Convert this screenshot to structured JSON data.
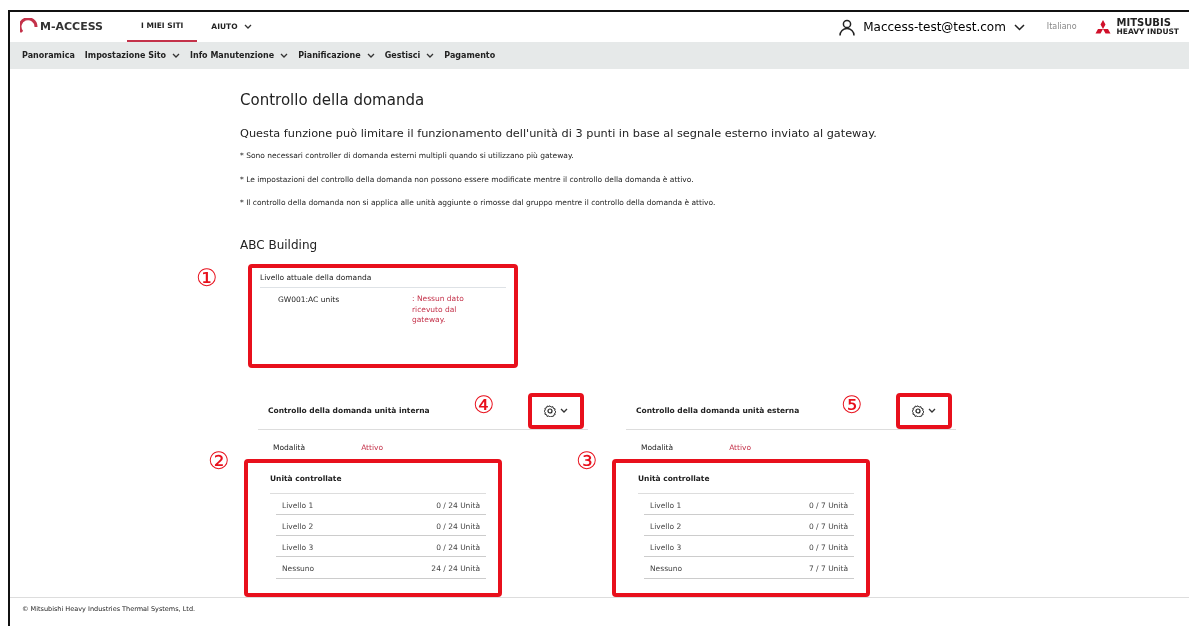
{
  "top_nav": {
    "logo": "M-ACCESS",
    "items": [
      {
        "label": "I MIEI SITI",
        "selected": true,
        "dropdown": false
      },
      {
        "label": "AIUTO",
        "selected": false,
        "dropdown": true
      }
    ],
    "user": "Maccess-test@test.com",
    "language": "Italiano",
    "brand": "MITSUBIS",
    "brand_sub": "HEAVY INDUST"
  },
  "sub_nav": [
    {
      "label": "Panoramica",
      "dropdown": false
    },
    {
      "label": "Impostazione Sito",
      "dropdown": true
    },
    {
      "label": "Info Manutenzione",
      "dropdown": true
    },
    {
      "label": "Pianificazione",
      "dropdown": true
    },
    {
      "label": "Gestisci",
      "dropdown": true
    },
    {
      "label": "Pagamento",
      "dropdown": false
    }
  ],
  "page": {
    "title": "Controllo della domanda",
    "subtitle": "Questa funzione può limitare il funzionamento dell'unità di 3 punti in base al segnale esterno inviato al gateway.",
    "notes": [
      "* Sono necessari controller di domanda esterni multipli quando si utilizzano più gateway.",
      "* Le impostazioni del controllo della domanda non possono essere modificate mentre il controllo della domanda è attivo.",
      "* Il controllo della domanda non si applica alle unità aggiunte o rimosse dal gruppo mentre il controllo della domanda è attivo."
    ],
    "building": "ABC Building"
  },
  "current_level": {
    "annotation": "①",
    "label": "Livello attuale della domanda",
    "gateway": "GW001:AC units",
    "status": ": Nessun dato ricevuto dal gateway."
  },
  "panels": [
    {
      "title": "Controllo della domanda unità interna",
      "gear_annotation": "④",
      "mode_label": "Modalità",
      "mode_value": "Attivo",
      "units_annotation": "②",
      "units_title": "Unità controllate",
      "rows": [
        {
          "label": "Livello 1",
          "value": "0 / 24 Unità"
        },
        {
          "label": "Livello 2",
          "value": "0 / 24 Unità"
        },
        {
          "label": "Livello 3",
          "value": "0 / 24 Unità"
        },
        {
          "label": "Nessuno",
          "value": "24 / 24 Unità"
        }
      ]
    },
    {
      "title": "Controllo della domanda unità esterna",
      "gear_annotation": "⑤",
      "mode_label": "Modalità",
      "mode_value": "Attivo",
      "units_annotation": "③",
      "units_title": "Unità controllate",
      "rows": [
        {
          "label": "Livello 1",
          "value": "0 / 7 Unità"
        },
        {
          "label": "Livello 2",
          "value": "0 / 7 Unità"
        },
        {
          "label": "Livello 3",
          "value": "0 / 7 Unità"
        },
        {
          "label": "Nessuno",
          "value": "7 / 7 Unità"
        }
      ]
    }
  ],
  "footer": "© Mitsubishi Heavy Industries Thermal Systems, Ltd."
}
